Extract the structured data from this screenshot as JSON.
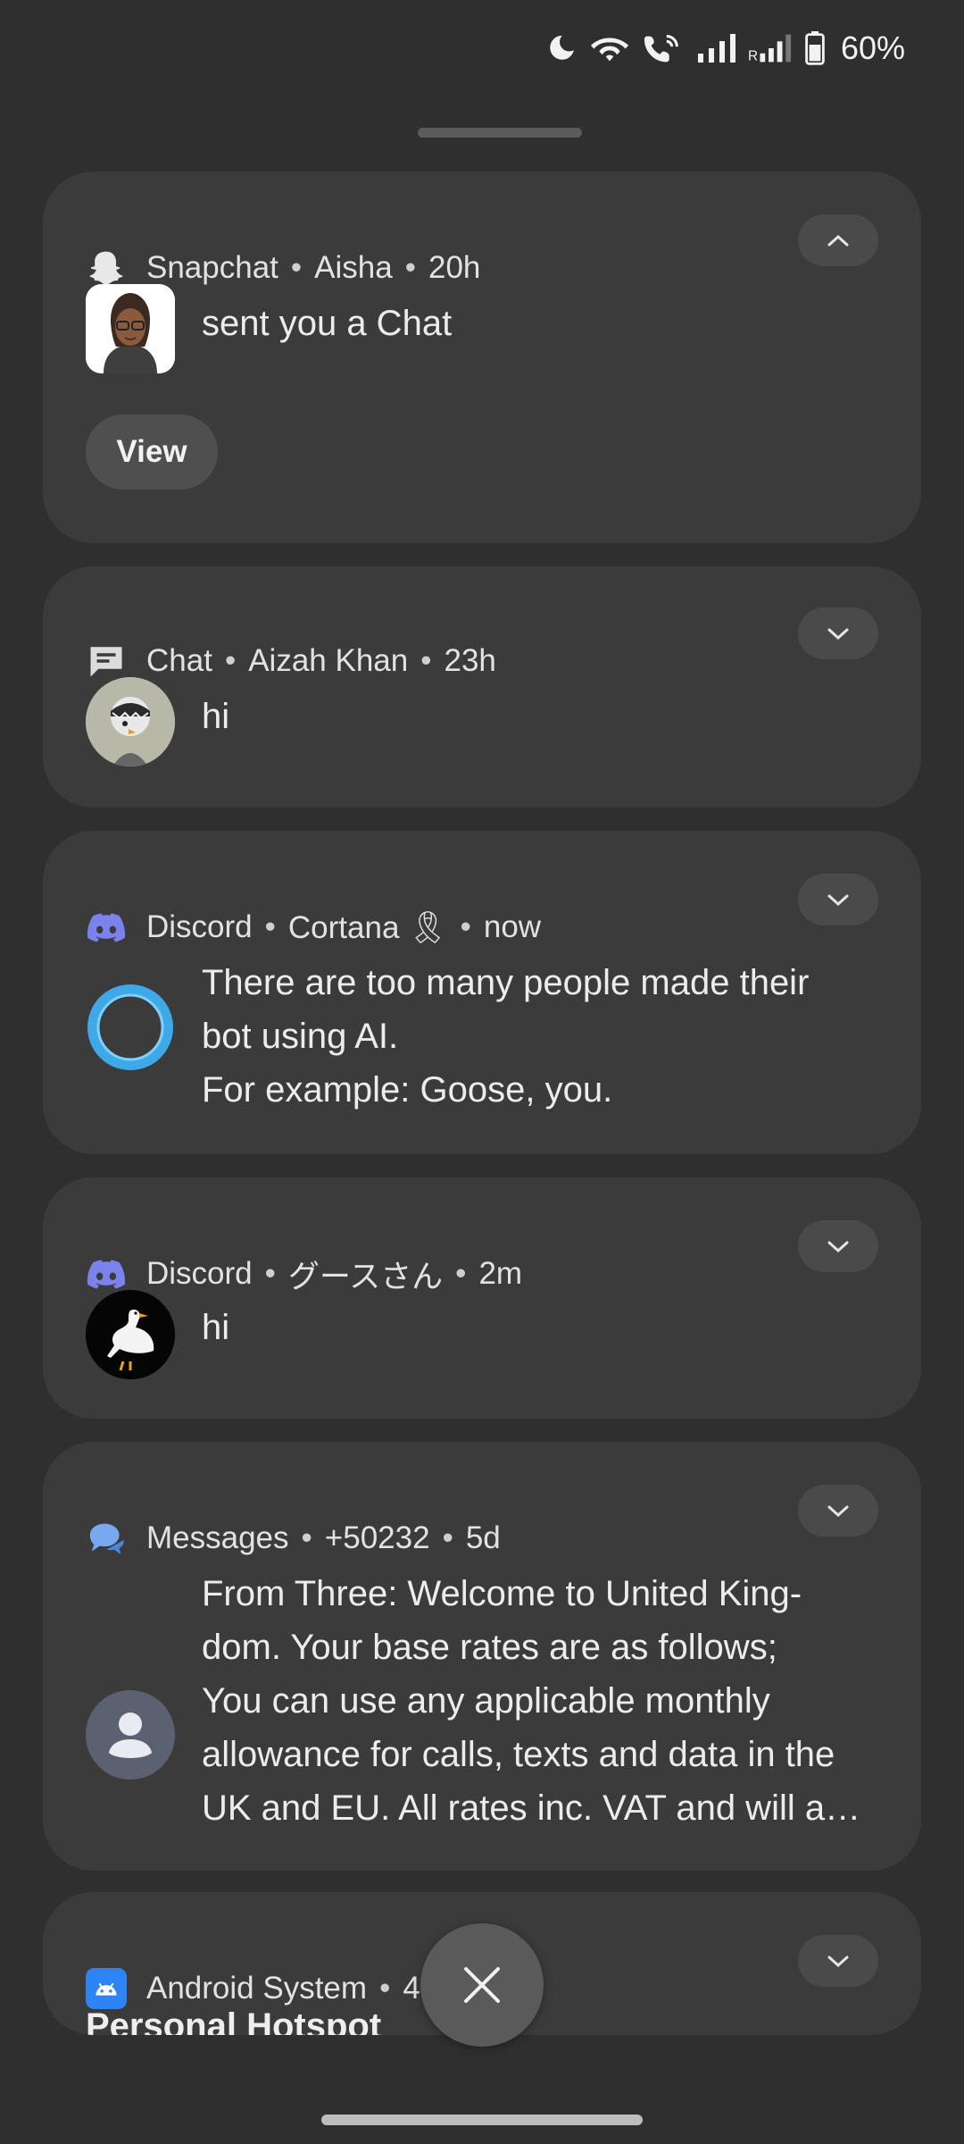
{
  "status_bar": {
    "battery_percent": "60%",
    "icons": [
      "moon-icon",
      "wifi-icon",
      "wifi-calling-icon",
      "signal-icon",
      "roaming-signal-icon",
      "battery-icon"
    ]
  },
  "notifications": [
    {
      "app": "Snapchat",
      "sender": "Aisha",
      "time": "20h",
      "message": "sent you a Chat",
      "action": "View",
      "expanded": true,
      "icon": "snapchat-ghost-icon"
    },
    {
      "app": "Chat",
      "sender": "Aizah Khan",
      "time": "23h",
      "message": "hi",
      "icon": "chat-bubble-icon"
    },
    {
      "app": "Discord",
      "sender": "Cortana 🎗",
      "time": "now",
      "message_lines": [
        "There are too many people made their",
        "bot using AI.",
        "For example: Goose, you."
      ],
      "icon": "discord-icon"
    },
    {
      "app": "Discord",
      "sender": "グースさん",
      "time": "2m",
      "message": "hi",
      "icon": "discord-icon"
    },
    {
      "app": "Messages",
      "sender": "+50232",
      "time": "5d",
      "message_lines": [
        "From Three: Welcome to United King-",
        "dom. Your base rates are as follows;",
        "You can use any applicable monthly",
        "allowance for calls, texts and data in the",
        "UK and EU. All rates inc. VAT and will a…"
      ],
      "icon": "messages-icon"
    },
    {
      "app": "Android System",
      "time_partial": "4",
      "title": "Personal Hotspot",
      "icon": "android-icon"
    }
  ],
  "colors": {
    "card": "#3b3b3b",
    "background": "#2f2f2f",
    "discord": "#7b83eb",
    "messages": "#78a9f0",
    "android": "#2f84f3"
  }
}
